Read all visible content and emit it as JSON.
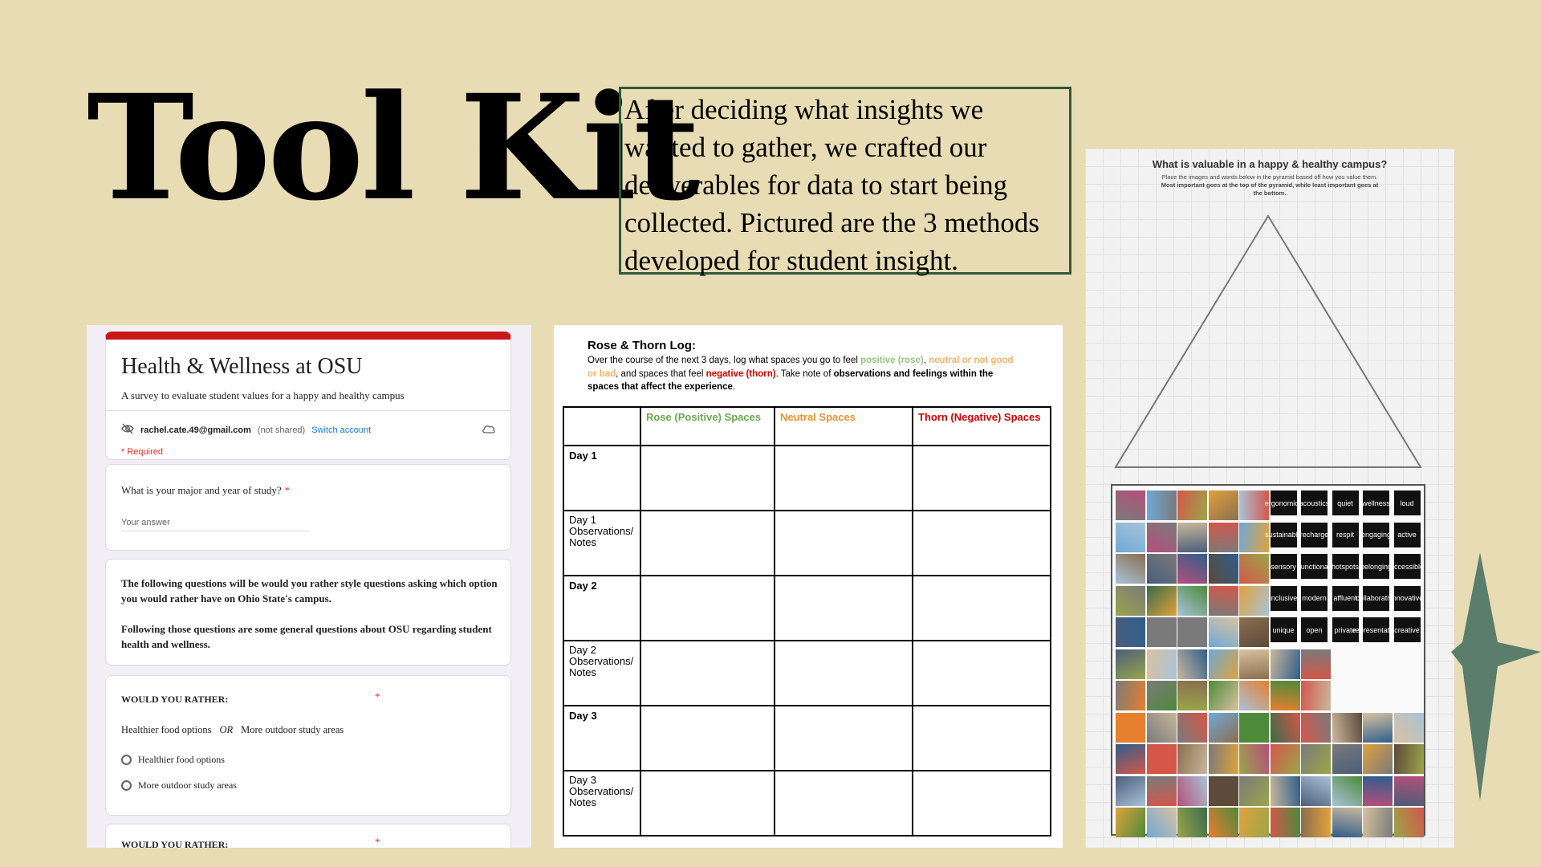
{
  "slide": {
    "title": "Tool Kit",
    "intro": "After deciding what insights we wanted to gather, we crafted our deliverables for data to start being collected. Pictured are the 3 methods developed for student insight."
  },
  "form": {
    "title": "Health & Wellness at OSU",
    "description": "A survey to evaluate student values for a happy and healthy campus",
    "account_email": "rachel.cate.49@gmail.com",
    "account_status": "(not shared)",
    "switch_account": "Switch account",
    "required_note": "* Required",
    "question1": "What is your major and year of study?",
    "required_star": "*",
    "answer_placeholder": "Your answer",
    "info_p1": "The following questions will be would you rather style questions asking which option you would rather have on Ohio State's campus.",
    "info_p2": "Following those questions are some general questions about OSU regarding student health and wellness.",
    "wyr_heading": "WOULD YOU RATHER:",
    "wyr_option_a": "Healthier food options",
    "wyr_or": "OR",
    "wyr_option_b": "More outdoor study areas",
    "radio_a": "Healthier food options",
    "radio_b": "More outdoor study areas",
    "wyr2_heading": "WOULD YOU RATHER:"
  },
  "log": {
    "title": "Rose & Thorn Log:",
    "text_1": "Over the course of the next 3 days, log what spaces you go to feel ",
    "text_positive": "positive (rose)",
    "text_2": ", ",
    "text_neutral": "neutral or not good or bad",
    "text_3": ", and spaces that feel ",
    "text_negative": "negative (thorn)",
    "text_4": ". Take note of ",
    "text_bold": "observations and feelings within the spaces that affect the experience",
    "text_5": ".",
    "headers": [
      "",
      "Rose (Positive) Spaces",
      "Neutral Spaces",
      "Thorn (Negative) Spaces"
    ],
    "rows": [
      "Day 1",
      "Day 1 Observations/ Notes",
      "Day 2",
      "Day 2 Observations/ Notes",
      "Day 3",
      "Day 3 Observations/ Notes"
    ]
  },
  "pyramid": {
    "title": "What is valuable in a happy & healthy campus?",
    "subtitle_1": "Place the images and words below in the pyramid based off how you value them. ",
    "subtitle_bold": "Most important goes at the top of the pyramid, while least important goes at the bottom.",
    "words": [
      "ergonomics",
      "acoustics",
      "quiet",
      "wellness",
      "loud",
      "sustainable",
      "recharge",
      "respit",
      "engaging",
      "active",
      "sensory",
      "functional",
      "hotspots",
      "belonging",
      "accessible",
      "inclusive",
      "modern",
      "affluent",
      "collaborative",
      "innovative",
      "unique",
      "open",
      "private",
      "representation",
      "creative"
    ]
  },
  "colors": {
    "background": "#e8dcb4",
    "intro_border": "#2f5a3a",
    "form_accent": "#c81818",
    "rose": "#6aa84f",
    "neutral": "#e69138",
    "thorn": "#cc0000",
    "star": "#5b7d6b"
  }
}
